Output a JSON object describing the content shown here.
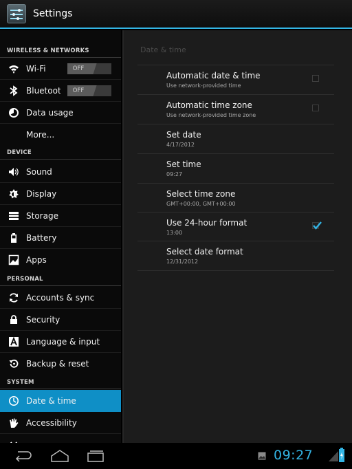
{
  "app": {
    "title": "Settings",
    "icon": "settings-app-icon"
  },
  "sidebar": {
    "headers": {
      "wireless": "WIRELESS & NETWORKS",
      "device": "DEVICE",
      "personal": "PERSONAL",
      "system": "SYSTEM"
    },
    "items": [
      {
        "label": "Wi-Fi",
        "icon": "wifi-icon",
        "toggle": "OFF"
      },
      {
        "label": "Bluetooth",
        "icon": "bluetooth-icon",
        "toggle": "OFF"
      },
      {
        "label": "Data usage",
        "icon": "data-usage-icon"
      },
      {
        "label": "More..."
      },
      {
        "label": "Sound",
        "icon": "sound-icon"
      },
      {
        "label": "Display",
        "icon": "display-icon"
      },
      {
        "label": "Storage",
        "icon": "storage-icon"
      },
      {
        "label": "Battery",
        "icon": "battery-icon"
      },
      {
        "label": "Apps",
        "icon": "apps-icon"
      },
      {
        "label": "Accounts & sync",
        "icon": "sync-icon"
      },
      {
        "label": "Security",
        "icon": "lock-icon"
      },
      {
        "label": "Language & input",
        "icon": "language-icon"
      },
      {
        "label": "Backup & reset",
        "icon": "backup-icon"
      },
      {
        "label": "Date & time",
        "icon": "clock-icon",
        "active": true
      },
      {
        "label": "Accessibility",
        "icon": "accessibility-icon"
      }
    ]
  },
  "content": {
    "section_title": "Date & time",
    "prefs": [
      {
        "title": "Automatic date & time",
        "summary": "Use network-provided time",
        "checked": false
      },
      {
        "title": "Automatic time zone",
        "summary": "Use network-provided time zone",
        "checked": false
      },
      {
        "title": "Set date",
        "summary": "4/17/2012"
      },
      {
        "title": "Set time",
        "summary": "09:27"
      },
      {
        "title": "Select time zone",
        "summary": "GMT+00:00, GMT+00:00"
      },
      {
        "title": "Use 24-hour format",
        "summary": "13:00",
        "checked": true
      },
      {
        "title": "Select date format",
        "summary": "12/31/2012"
      }
    ]
  },
  "status_bar": {
    "time": "09:27"
  },
  "colors": {
    "accent": "#33b5e5",
    "active_item": "#0f8fc6"
  }
}
